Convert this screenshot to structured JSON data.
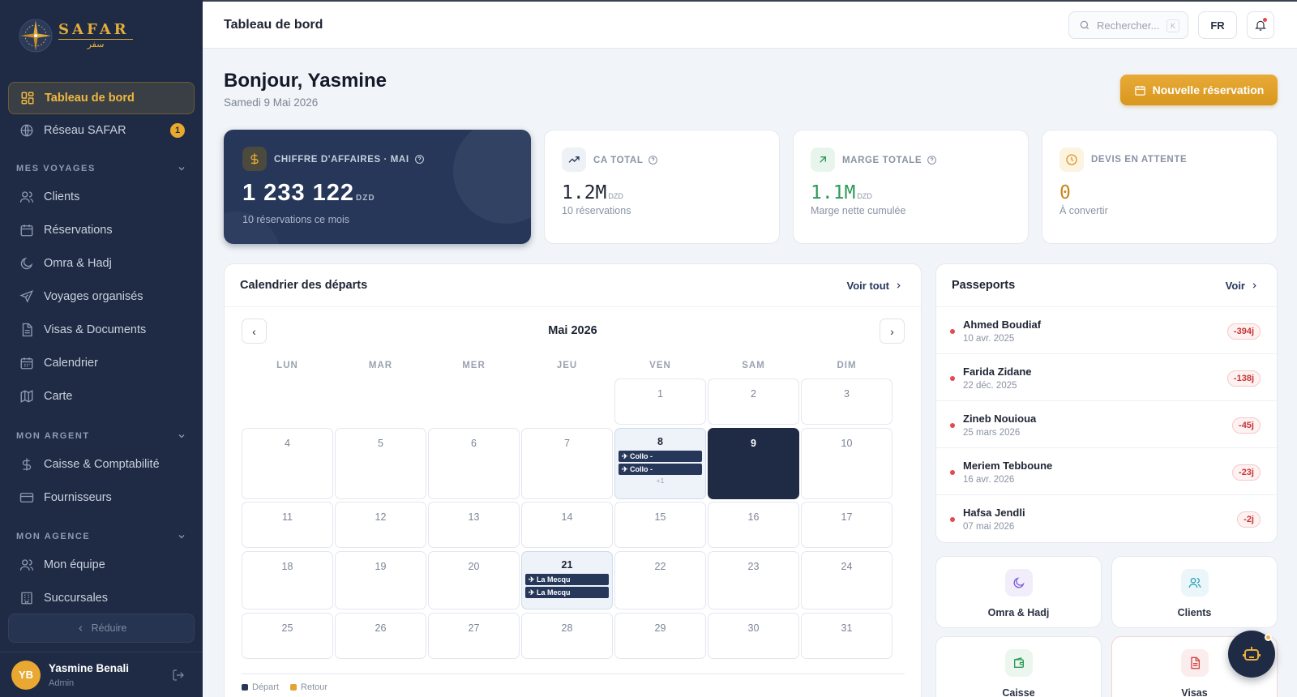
{
  "brand": {
    "name": "SAFAR",
    "arabic": "سفر"
  },
  "sidebar": {
    "items": [
      {
        "label": "Tableau de bord",
        "icon": "dashboard-icon",
        "active": true
      },
      {
        "label": "Réseau SAFAR",
        "icon": "globe-icon",
        "badge": "1"
      }
    ],
    "sections": [
      {
        "title": "MES VOYAGES",
        "items": [
          {
            "label": "Clients",
            "icon": "users-icon"
          },
          {
            "label": "Réservations",
            "icon": "calendar-icon"
          },
          {
            "label": "Omra & Hadj",
            "icon": "moon-icon"
          },
          {
            "label": "Voyages organisés",
            "icon": "plane-icon"
          },
          {
            "label": "Visas & Documents",
            "icon": "document-icon"
          },
          {
            "label": "Calendrier",
            "icon": "calendar-grid-icon"
          },
          {
            "label": "Carte",
            "icon": "map-icon"
          }
        ]
      },
      {
        "title": "MON ARGENT",
        "items": [
          {
            "label": "Caisse & Comptabilité",
            "icon": "dollar-icon"
          },
          {
            "label": "Fournisseurs",
            "icon": "card-icon"
          }
        ]
      },
      {
        "title": "MON AGENCE",
        "items": [
          {
            "label": "Mon équipe",
            "icon": "team-icon"
          },
          {
            "label": "Succursales",
            "icon": "building-icon"
          }
        ]
      }
    ],
    "reduce_label": "Réduire",
    "user": {
      "initials": "YB",
      "name": "Yasmine Benali",
      "role": "Admin"
    }
  },
  "header": {
    "title": "Tableau de bord",
    "search_placeholder": "Rechercher...",
    "search_shortcut": "K",
    "lang": "FR"
  },
  "greeting": {
    "title": "Bonjour, Yasmine",
    "date": "Samedi 9 Mai 2026",
    "cta": "Nouvelle réservation"
  },
  "kpis": [
    {
      "label": "CHIFFRE D'AFFAIRES · MAI",
      "value": "1 233 122",
      "unit": "DZD",
      "sub": "10 réservations ce mois",
      "help": true
    },
    {
      "label": "CA TOTAL",
      "value": "1.2M",
      "unit": "DZD",
      "sub": "10 réservations",
      "help": true
    },
    {
      "label": "MARGE TOTALE",
      "value": "1.1M",
      "unit": "DZD",
      "sub": "Marge nette cumulée",
      "help": true
    },
    {
      "label": "DEVIS EN ATTENTE",
      "value": "0",
      "unit": "",
      "sub": "À convertir",
      "help": false
    }
  ],
  "calendar": {
    "title": "Calendrier des départs",
    "view_all": "Voir tout",
    "month": "Mai 2026",
    "prev": "‹",
    "next": "›",
    "weekdays": [
      "LUN",
      "MAR",
      "MER",
      "JEU",
      "VEN",
      "SAM",
      "DIM"
    ],
    "first_weekday_index": 4,
    "days_in_month": 31,
    "today": 9,
    "events": {
      "8": {
        "items": [
          "Collo -",
          "Collo -"
        ],
        "more": "+1"
      },
      "21": {
        "items": [
          "La Mecqu",
          "La Mecqu"
        ],
        "more": ""
      }
    },
    "legend": [
      {
        "label": "Départ",
        "color": "#26375a"
      },
      {
        "label": "Retour",
        "color": "#e3a432"
      }
    ]
  },
  "passports": {
    "title": "Passeports",
    "view": "Voir",
    "rows": [
      {
        "name": "Ahmed Boudiaf",
        "date": "10 avr. 2025",
        "badge": "-394j"
      },
      {
        "name": "Farida Zidane",
        "date": "22 déc. 2025",
        "badge": "-138j"
      },
      {
        "name": "Zineb Nouioua",
        "date": "25 mars 2026",
        "badge": "-45j"
      },
      {
        "name": "Meriem Tebboune",
        "date": "16 avr. 2026",
        "badge": "-23j"
      },
      {
        "name": "Hafsa Jendli",
        "date": "07 mai 2026",
        "badge": "-2j"
      }
    ]
  },
  "shortcuts": [
    {
      "label": "Omra & Hadj",
      "icon": "moon-icon",
      "color": "#7c5cd6",
      "bg": "#f1edfb"
    },
    {
      "label": "Clients",
      "icon": "users-icon",
      "color": "#2c9fb8",
      "bg": "#eaf6f9"
    },
    {
      "label": "Caisse",
      "icon": "wallet-icon",
      "color": "#2e9a57",
      "bg": "#eaf6ee"
    },
    {
      "label": "Visas",
      "icon": "document-icon",
      "color": "#d64545",
      "bg": "#fbeded"
    }
  ],
  "colors": {
    "accent": "#e9a92c",
    "sidebar": "#1f2b44",
    "navy": "#26375a",
    "danger": "#e5484d"
  }
}
